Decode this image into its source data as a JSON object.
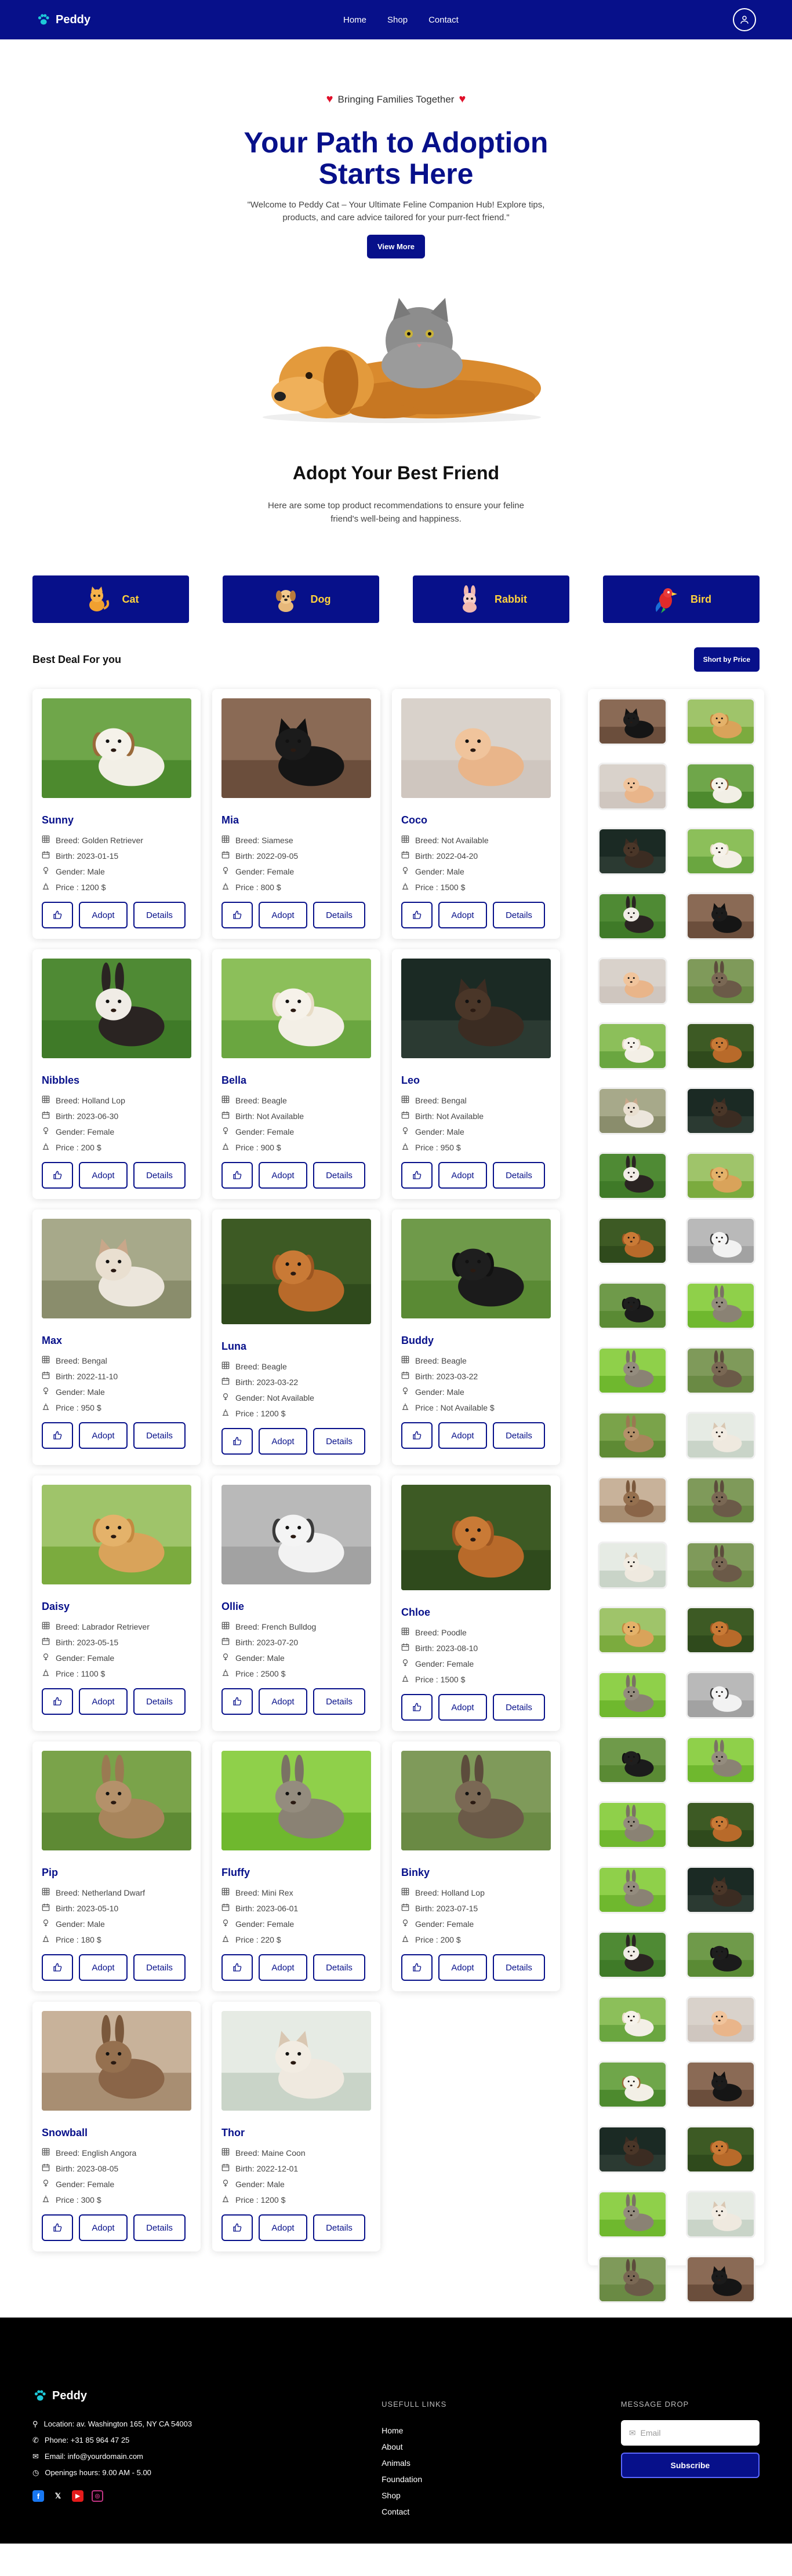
{
  "nav": {
    "brand": "Peddy",
    "links": [
      "Home",
      "Shop",
      "Contact"
    ]
  },
  "hero": {
    "tagline": "Bringing Families Together",
    "title": "Your Path to Adoption Starts Here",
    "description": "\"Welcome to Peddy Cat – Your Ultimate Feline Companion Hub! Explore tips, products, and care advice tailored for your purr-fect friend.\"",
    "cta": "View More"
  },
  "adopt": {
    "title": "Adopt Your Best Friend",
    "description": "Here are some top product recommendations to ensure your feline friend's well-being and happiness."
  },
  "categories": [
    "Cat",
    "Dog",
    "Rabbit",
    "Bird"
  ],
  "deals": {
    "title": "Best Deal For you",
    "sort_label": "Short by Price"
  },
  "card_buttons": {
    "adopt": "Adopt",
    "details": "Details"
  },
  "pets": [
    {
      "name": "Sunny",
      "breed": "Breed: Golden Retriever",
      "birth": "Birth: 2023-01-15",
      "gender": "Gender: Male",
      "price": "Price : 1200 $",
      "img": "dog-terrier"
    },
    {
      "name": "Mia",
      "breed": "Breed: Siamese",
      "birth": "Birth: 2022-09-05",
      "gender": "Gender: Female",
      "price": "Price : 800 $",
      "img": "cat-black"
    },
    {
      "name": "Coco",
      "breed": "Breed: Not Available",
      "birth": "Birth: 2022-04-20",
      "gender": "Gender: Male",
      "price": "Price : 1500 $",
      "img": "hamster"
    },
    {
      "name": "Nibbles",
      "breed": "Breed: Holland Lop",
      "birth": "Birth: 2023-06-30",
      "gender": "Gender: Female",
      "price": "Price : 200 $",
      "img": "rabbit-bw"
    },
    {
      "name": "Bella",
      "breed": "Breed: Beagle",
      "birth": "Birth: Not Available",
      "gender": "Gender: Female",
      "price": "Price : 900 $",
      "img": "dog-white"
    },
    {
      "name": "Leo",
      "breed": "Breed: Bengal",
      "birth": "Birth: Not Available",
      "gender": "Gender: Male",
      "price": "Price : 950 $",
      "img": "cat-dark"
    },
    {
      "name": "Max",
      "breed": "Breed: Bengal",
      "birth": "Birth: 2022-11-10",
      "gender": "Gender: Male",
      "price": "Price : 950 $",
      "img": "cat-white"
    },
    {
      "name": "Luna",
      "breed": "Breed: Beagle",
      "birth": "Birth: 2023-03-22",
      "gender": "Gender: Not Available",
      "price": "Price : 1200 $",
      "img": "dog-golden"
    },
    {
      "name": "Buddy",
      "breed": "Breed: Beagle",
      "birth": "Birth: 2023-03-22",
      "gender": "Gender: Male",
      "price": "Price : Not Available $",
      "img": "dog-collie"
    },
    {
      "name": "Daisy",
      "breed": "Breed: Labrador Retriever",
      "birth": "Birth: 2023-05-15",
      "gender": "Gender: Female",
      "price": "Price : 1100 $",
      "img": "dog-run"
    },
    {
      "name": "Ollie",
      "breed": "Breed: French Bulldog",
      "birth": "Birth: 2023-07-20",
      "gender": "Gender: Male",
      "price": "Price : 2500 $",
      "img": "dog-shihtzu"
    },
    {
      "name": "Chloe",
      "breed": "Breed: Poodle",
      "birth": "Birth: 2023-08-10",
      "gender": "Gender: Female",
      "price": "Price : 1500 $",
      "img": "dog-golden"
    },
    {
      "name": "Pip",
      "breed": "Breed: Netherland Dwarf",
      "birth": "Birth: 2023-05-10",
      "gender": "Gender: Male",
      "price": "Price : 180 $",
      "img": "rabbit-brown"
    },
    {
      "name": "Fluffy",
      "breed": "Breed: Mini Rex",
      "birth": "Birth: 2023-06-01",
      "gender": "Gender: Female",
      "price": "Price : 220 $",
      "img": "rabbit-grass"
    },
    {
      "name": "Binky",
      "breed": "Breed: Holland Lop",
      "birth": "Birth: 2023-07-15",
      "gender": "Gender: Female",
      "price": "Price : 200 $",
      "img": "rabbit-wild"
    },
    {
      "name": "Snowball",
      "breed": "Breed: English Angora",
      "birth": "Birth: 2023-08-05",
      "gender": "Gender: Female",
      "price": "Price : 300 $",
      "img": "rabbit-hutch"
    },
    {
      "name": "Thor",
      "breed": "Breed: Maine Coon",
      "birth": "Birth: 2022-12-01",
      "gender": "Gender: Male",
      "price": "Price : 1200 $",
      "img": "cat-fluffy"
    }
  ],
  "liked_thumbs": [
    "cat-black",
    "dog-run",
    "hamster",
    "dog-terrier",
    "cat-dark",
    "dog-white",
    "rabbit-bw",
    "cat-black",
    "hamster",
    "rabbit-wild",
    "dog-white",
    "dog-golden",
    "cat-white",
    "cat-dark",
    "rabbit-bw",
    "dog-run",
    "dog-golden",
    "dog-shihtzu",
    "dog-collie",
    "rabbit-grass",
    "rabbit-grass",
    "rabbit-wild",
    "rabbit-brown",
    "cat-fluffy",
    "rabbit-hutch",
    "rabbit-wild",
    "cat-fluffy",
    "rabbit-wild",
    "dog-run",
    "dog-golden",
    "rabbit-grass",
    "dog-shihtzu",
    "dog-collie",
    "rabbit-grass",
    "rabbit-grass",
    "dog-golden",
    "rabbit-grass",
    "cat-dark",
    "rabbit-bw",
    "dog-collie",
    "dog-white",
    "hamster",
    "dog-terrier",
    "cat-black",
    "cat-dark",
    "dog-golden",
    "rabbit-grass",
    "cat-fluffy",
    "rabbit-wild",
    "cat-black"
  ],
  "footer": {
    "brand": "Peddy",
    "location": "Location: av. Washington 165, NY CA 54003",
    "phone": "Phone: +31 85 964 47 25",
    "email": "Email: info@yourdomain.com",
    "hours": "Openings hours: 9.00 AM - 5.00",
    "links_title": "USEFULL LINKS",
    "links": [
      "Home",
      "About",
      "Animals",
      "Foundation",
      "Shop",
      "Contact"
    ],
    "msg_title": "MESSAGE DROP",
    "email_placeholder": "Email",
    "subscribe": "Subscribe"
  }
}
